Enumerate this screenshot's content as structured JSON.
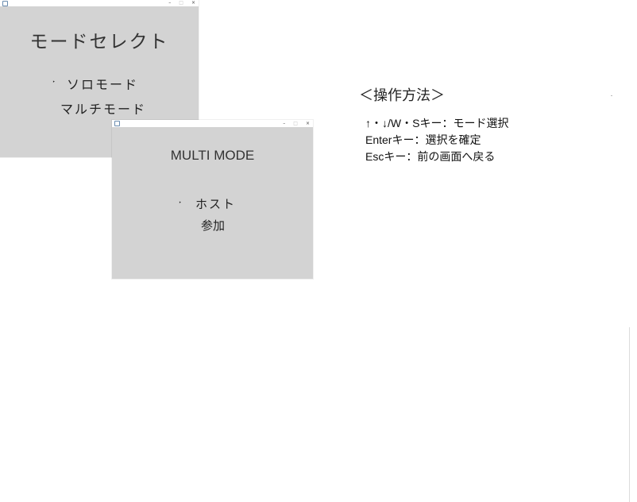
{
  "solo_window": {
    "title_icon": "app-icon",
    "window_title": "",
    "controls": {
      "minimize": "–",
      "maximize": "□",
      "close": "×"
    },
    "heading": "モードセレクト",
    "cursor": "‣",
    "items": [
      "ソロモード",
      "マルチモード"
    ],
    "background": "#d3d3d3"
  },
  "multi_window": {
    "title_icon": "app-icon",
    "window_title": "",
    "controls": {
      "minimize": "–",
      "maximize": "□",
      "close": "×"
    },
    "heading": "MULTI MODE",
    "cursor": "‣",
    "items": [
      "ホスト",
      "参加"
    ],
    "background": "#d3d3d3"
  },
  "help": {
    "heading": "＜操作方法＞",
    "lines": [
      "↑・↓/W・Sキー：モード選択",
      "Enterキー：選択を確定",
      "Escキー：前の画面へ戻る"
    ]
  }
}
